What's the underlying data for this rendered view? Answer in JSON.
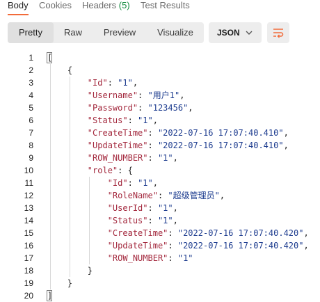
{
  "tabs": [
    {
      "label": "Body",
      "count": ""
    },
    {
      "label": "Cookies",
      "count": ""
    },
    {
      "label": "Headers",
      "count": "(5)"
    },
    {
      "label": "Test Results",
      "count": ""
    }
  ],
  "view_modes": [
    "Pretty",
    "Raw",
    "Preview",
    "Visualize"
  ],
  "format_select": "JSON",
  "icons": {
    "format_chevron": "chevron-down-icon",
    "wrap": "wrap-lines-icon"
  },
  "colors": {
    "accent": "#f26b3a",
    "count": "#0f8a3c",
    "key": "#a3283d",
    "string": "#1d3c8f"
  },
  "code_lines": [
    {
      "n": "1",
      "tokens": [
        {
          "t": "[",
          "c": "p"
        }
      ]
    },
    {
      "n": "2",
      "tokens": [
        {
          "t": "    {",
          "c": "p"
        }
      ]
    },
    {
      "n": "3",
      "tokens": [
        {
          "t": "        ",
          "c": "p"
        },
        {
          "t": "\"Id\"",
          "c": "k"
        },
        {
          "t": ": ",
          "c": "p"
        },
        {
          "t": "\"1\"",
          "c": "s"
        },
        {
          "t": ",",
          "c": "p"
        }
      ]
    },
    {
      "n": "4",
      "tokens": [
        {
          "t": "        ",
          "c": "p"
        },
        {
          "t": "\"Username\"",
          "c": "k"
        },
        {
          "t": ": ",
          "c": "p"
        },
        {
          "t": "\"用户1\"",
          "c": "s"
        },
        {
          "t": ",",
          "c": "p"
        }
      ]
    },
    {
      "n": "5",
      "tokens": [
        {
          "t": "        ",
          "c": "p"
        },
        {
          "t": "\"Password\"",
          "c": "k"
        },
        {
          "t": ": ",
          "c": "p"
        },
        {
          "t": "\"123456\"",
          "c": "s"
        },
        {
          "t": ",",
          "c": "p"
        }
      ]
    },
    {
      "n": "6",
      "tokens": [
        {
          "t": "        ",
          "c": "p"
        },
        {
          "t": "\"Status\"",
          "c": "k"
        },
        {
          "t": ": ",
          "c": "p"
        },
        {
          "t": "\"1\"",
          "c": "s"
        },
        {
          "t": ",",
          "c": "p"
        }
      ]
    },
    {
      "n": "7",
      "tokens": [
        {
          "t": "        ",
          "c": "p"
        },
        {
          "t": "\"CreateTime\"",
          "c": "k"
        },
        {
          "t": ": ",
          "c": "p"
        },
        {
          "t": "\"2022-07-16 17:07:40.410\"",
          "c": "s"
        },
        {
          "t": ",",
          "c": "p"
        }
      ]
    },
    {
      "n": "8",
      "tokens": [
        {
          "t": "        ",
          "c": "p"
        },
        {
          "t": "\"UpdateTime\"",
          "c": "k"
        },
        {
          "t": ": ",
          "c": "p"
        },
        {
          "t": "\"2022-07-16 17:07:40.410\"",
          "c": "s"
        },
        {
          "t": ",",
          "c": "p"
        }
      ]
    },
    {
      "n": "9",
      "tokens": [
        {
          "t": "        ",
          "c": "p"
        },
        {
          "t": "\"ROW_NUMBER\"",
          "c": "k"
        },
        {
          "t": ": ",
          "c": "p"
        },
        {
          "t": "\"1\"",
          "c": "s"
        },
        {
          "t": ",",
          "c": "p"
        }
      ]
    },
    {
      "n": "10",
      "tokens": [
        {
          "t": "        ",
          "c": "p"
        },
        {
          "t": "\"role\"",
          "c": "k"
        },
        {
          "t": ": {",
          "c": "p"
        }
      ]
    },
    {
      "n": "11",
      "tokens": [
        {
          "t": "            ",
          "c": "p"
        },
        {
          "t": "\"Id\"",
          "c": "k"
        },
        {
          "t": ": ",
          "c": "p"
        },
        {
          "t": "\"1\"",
          "c": "s"
        },
        {
          "t": ",",
          "c": "p"
        }
      ]
    },
    {
      "n": "12",
      "tokens": [
        {
          "t": "            ",
          "c": "p"
        },
        {
          "t": "\"RoleName\"",
          "c": "k"
        },
        {
          "t": ": ",
          "c": "p"
        },
        {
          "t": "\"超级管理员\"",
          "c": "s"
        },
        {
          "t": ",",
          "c": "p"
        }
      ]
    },
    {
      "n": "13",
      "tokens": [
        {
          "t": "            ",
          "c": "p"
        },
        {
          "t": "\"UserId\"",
          "c": "k"
        },
        {
          "t": ": ",
          "c": "p"
        },
        {
          "t": "\"1\"",
          "c": "s"
        },
        {
          "t": ",",
          "c": "p"
        }
      ]
    },
    {
      "n": "14",
      "tokens": [
        {
          "t": "            ",
          "c": "p"
        },
        {
          "t": "\"Status\"",
          "c": "k"
        },
        {
          "t": ": ",
          "c": "p"
        },
        {
          "t": "\"1\"",
          "c": "s"
        },
        {
          "t": ",",
          "c": "p"
        }
      ]
    },
    {
      "n": "15",
      "tokens": [
        {
          "t": "            ",
          "c": "p"
        },
        {
          "t": "\"CreateTime\"",
          "c": "k"
        },
        {
          "t": ": ",
          "c": "p"
        },
        {
          "t": "\"2022-07-16 17:07:40.420\"",
          "c": "s"
        },
        {
          "t": ",",
          "c": "p"
        }
      ]
    },
    {
      "n": "16",
      "tokens": [
        {
          "t": "            ",
          "c": "p"
        },
        {
          "t": "\"UpdateTime\"",
          "c": "k"
        },
        {
          "t": ": ",
          "c": "p"
        },
        {
          "t": "\"2022-07-16 17:07:40.420\"",
          "c": "s"
        },
        {
          "t": ",",
          "c": "p"
        }
      ]
    },
    {
      "n": "17",
      "tokens": [
        {
          "t": "            ",
          "c": "p"
        },
        {
          "t": "\"ROW_NUMBER\"",
          "c": "k"
        },
        {
          "t": ": ",
          "c": "p"
        },
        {
          "t": "\"1\"",
          "c": "s"
        }
      ]
    },
    {
      "n": "18",
      "tokens": [
        {
          "t": "        }",
          "c": "p"
        }
      ]
    },
    {
      "n": "19",
      "tokens": [
        {
          "t": "    }",
          "c": "p"
        }
      ]
    },
    {
      "n": "20",
      "tokens": [
        {
          "t": "]",
          "c": "p"
        }
      ]
    }
  ]
}
